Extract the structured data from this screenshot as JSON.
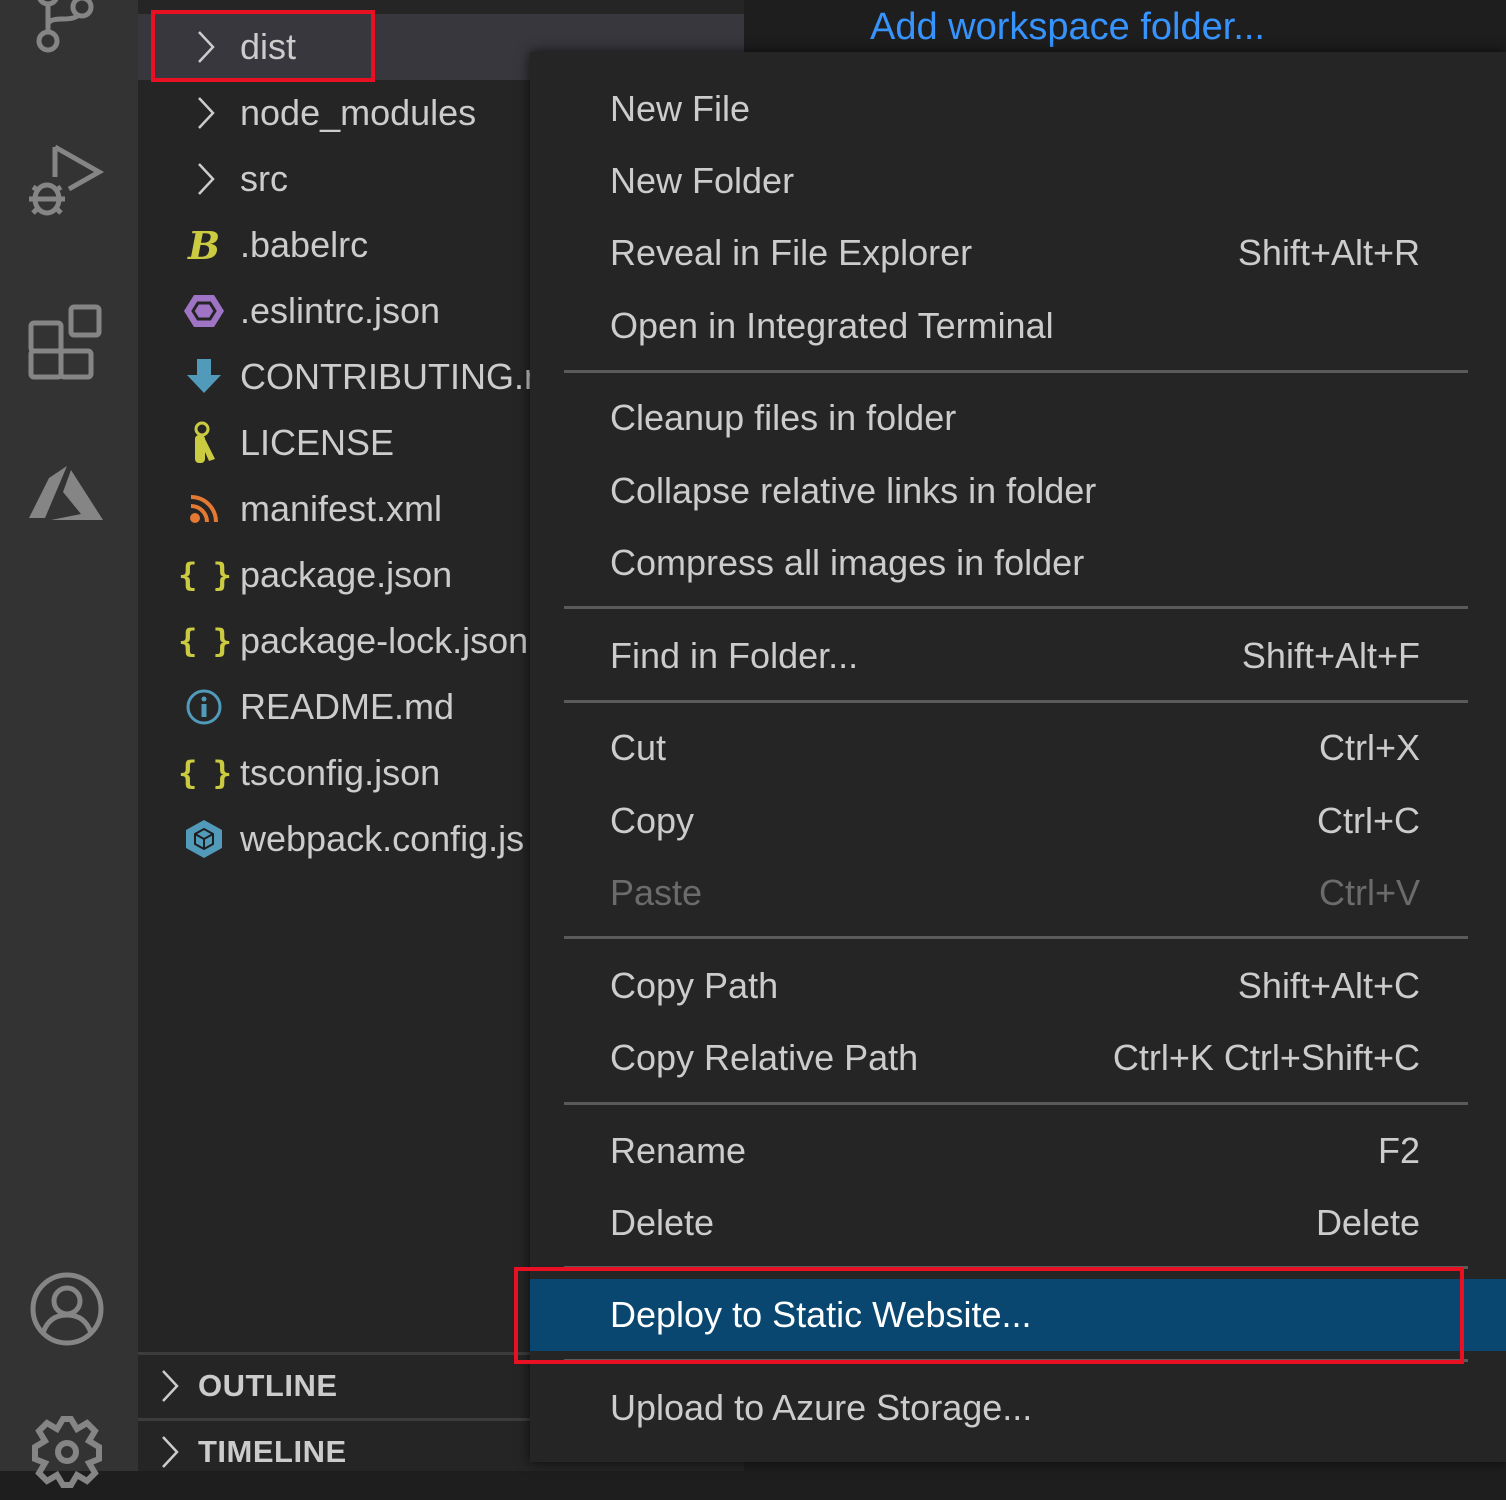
{
  "activity_bar": {
    "items": [
      {
        "icon": "source-control-icon"
      },
      {
        "icon": "run-debug-icon"
      },
      {
        "icon": "extensions-icon"
      },
      {
        "icon": "azure-icon"
      },
      {
        "icon": "account-icon"
      },
      {
        "icon": "settings-gear-icon"
      }
    ]
  },
  "explorer": {
    "items": [
      {
        "label": "dist",
        "type": "folder",
        "selected": true
      },
      {
        "label": "node_modules",
        "type": "folder"
      },
      {
        "label": "src",
        "type": "folder"
      },
      {
        "label": ".babelrc",
        "type": "file",
        "icon": "babel-icon",
        "icon_color": "#cbcb41"
      },
      {
        "label": ".eslintrc.json",
        "type": "file",
        "icon": "eslint-icon",
        "icon_color": "#a074c4"
      },
      {
        "label": "CONTRIBUTING.md",
        "type": "file",
        "icon": "markdown-download-icon",
        "icon_color": "#519aba"
      },
      {
        "label": "LICENSE",
        "type": "file",
        "icon": "license-key-icon",
        "icon_color": "#cbcb41"
      },
      {
        "label": "manifest.xml",
        "type": "file",
        "icon": "xml-rss-icon",
        "icon_color": "#e37933"
      },
      {
        "label": "package.json",
        "type": "file",
        "icon": "json-braces-icon",
        "icon_color": "#cbcb41"
      },
      {
        "label": "package-lock.json",
        "type": "file",
        "icon": "json-braces-icon",
        "icon_color": "#cbcb41"
      },
      {
        "label": "README.md",
        "type": "file",
        "icon": "info-icon",
        "icon_color": "#519aba"
      },
      {
        "label": "tsconfig.json",
        "type": "file",
        "icon": "json-braces-icon",
        "icon_color": "#cbcb41"
      },
      {
        "label": "webpack.config.js",
        "type": "file",
        "icon": "webpack-cube-icon",
        "icon_color": "#519aba"
      }
    ],
    "sections": [
      {
        "label": "OUTLINE"
      },
      {
        "label": "TIMELINE"
      }
    ]
  },
  "editor": {
    "add_workspace_folder": "Add workspace folder..."
  },
  "context_menu": {
    "groups": [
      [
        {
          "label": "New File",
          "shortcut": ""
        },
        {
          "label": "New Folder",
          "shortcut": ""
        },
        {
          "label": "Reveal in File Explorer",
          "shortcut": "Shift+Alt+R"
        },
        {
          "label": "Open in Integrated Terminal",
          "shortcut": ""
        }
      ],
      [
        {
          "label": "Cleanup files in folder",
          "shortcut": ""
        },
        {
          "label": "Collapse relative links in folder",
          "shortcut": ""
        },
        {
          "label": "Compress all images in folder",
          "shortcut": ""
        }
      ],
      [
        {
          "label": "Find in Folder...",
          "shortcut": "Shift+Alt+F"
        }
      ],
      [
        {
          "label": "Cut",
          "shortcut": "Ctrl+X"
        },
        {
          "label": "Copy",
          "shortcut": "Ctrl+C"
        },
        {
          "label": "Paste",
          "shortcut": "Ctrl+V",
          "disabled": true
        }
      ],
      [
        {
          "label": "Copy Path",
          "shortcut": "Shift+Alt+C"
        },
        {
          "label": "Copy Relative Path",
          "shortcut": "Ctrl+K Ctrl+Shift+C"
        }
      ],
      [
        {
          "label": "Rename",
          "shortcut": "F2"
        },
        {
          "label": "Delete",
          "shortcut": "Delete"
        }
      ],
      [
        {
          "label": "Deploy to Static Website...",
          "shortcut": "",
          "active": true
        }
      ],
      [
        {
          "label": "Upload to Azure Storage...",
          "shortcut": ""
        }
      ]
    ]
  },
  "colors": {
    "accent_link": "#3794ff",
    "menu_active_bg": "#094771",
    "highlight_box": "#e81123"
  }
}
